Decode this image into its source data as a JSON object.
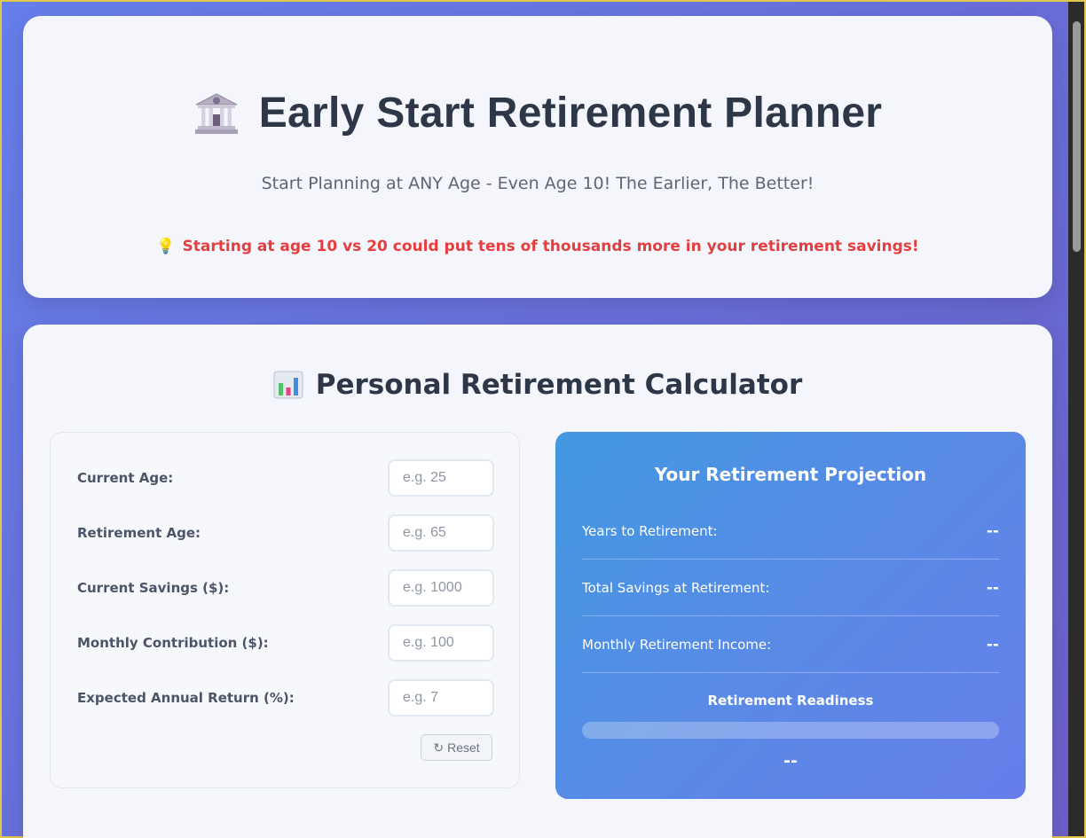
{
  "header": {
    "icon": "bank-icon",
    "title": "Early Start Retirement Planner",
    "subtitle": "Start Planning at ANY Age - Even Age 10! The Earlier, The Better!",
    "tip_icon": "lightbulb-icon",
    "tip": "Starting at age 10 vs 20 could put tens of thousands more in your retirement savings!"
  },
  "calculator": {
    "icon": "bar-chart-icon",
    "title": "Personal Retirement Calculator",
    "fields": [
      {
        "label": "Current Age:",
        "value": "",
        "placeholder": "e.g. 25"
      },
      {
        "label": "Retirement Age:",
        "value": "",
        "placeholder": "e.g. 65"
      },
      {
        "label": "Current Savings ($):",
        "value": "",
        "placeholder": "e.g. 1000"
      },
      {
        "label": "Monthly Contribution ($):",
        "value": "",
        "placeholder": "e.g. 100"
      },
      {
        "label": "Expected Annual Return (%):",
        "value": "",
        "placeholder": "e.g. 7"
      }
    ],
    "reset_icon": "refresh-icon",
    "reset_label": "Reset"
  },
  "projection": {
    "title": "Your Retirement Projection",
    "rows": [
      {
        "label": "Years to Retirement:",
        "value": "--"
      },
      {
        "label": "Total Savings at Retirement:",
        "value": "--"
      },
      {
        "label": "Monthly Retirement Income:",
        "value": "--"
      }
    ],
    "readiness_label": "Retirement Readiness",
    "readiness_progress": 0,
    "readiness_value": "--"
  },
  "colors": {
    "background_start": "#667eea",
    "background_end": "#6b5fc7",
    "tip_red": "#e53e3e",
    "panel_blue": "#4299e1",
    "title_text": "#2d3748"
  }
}
